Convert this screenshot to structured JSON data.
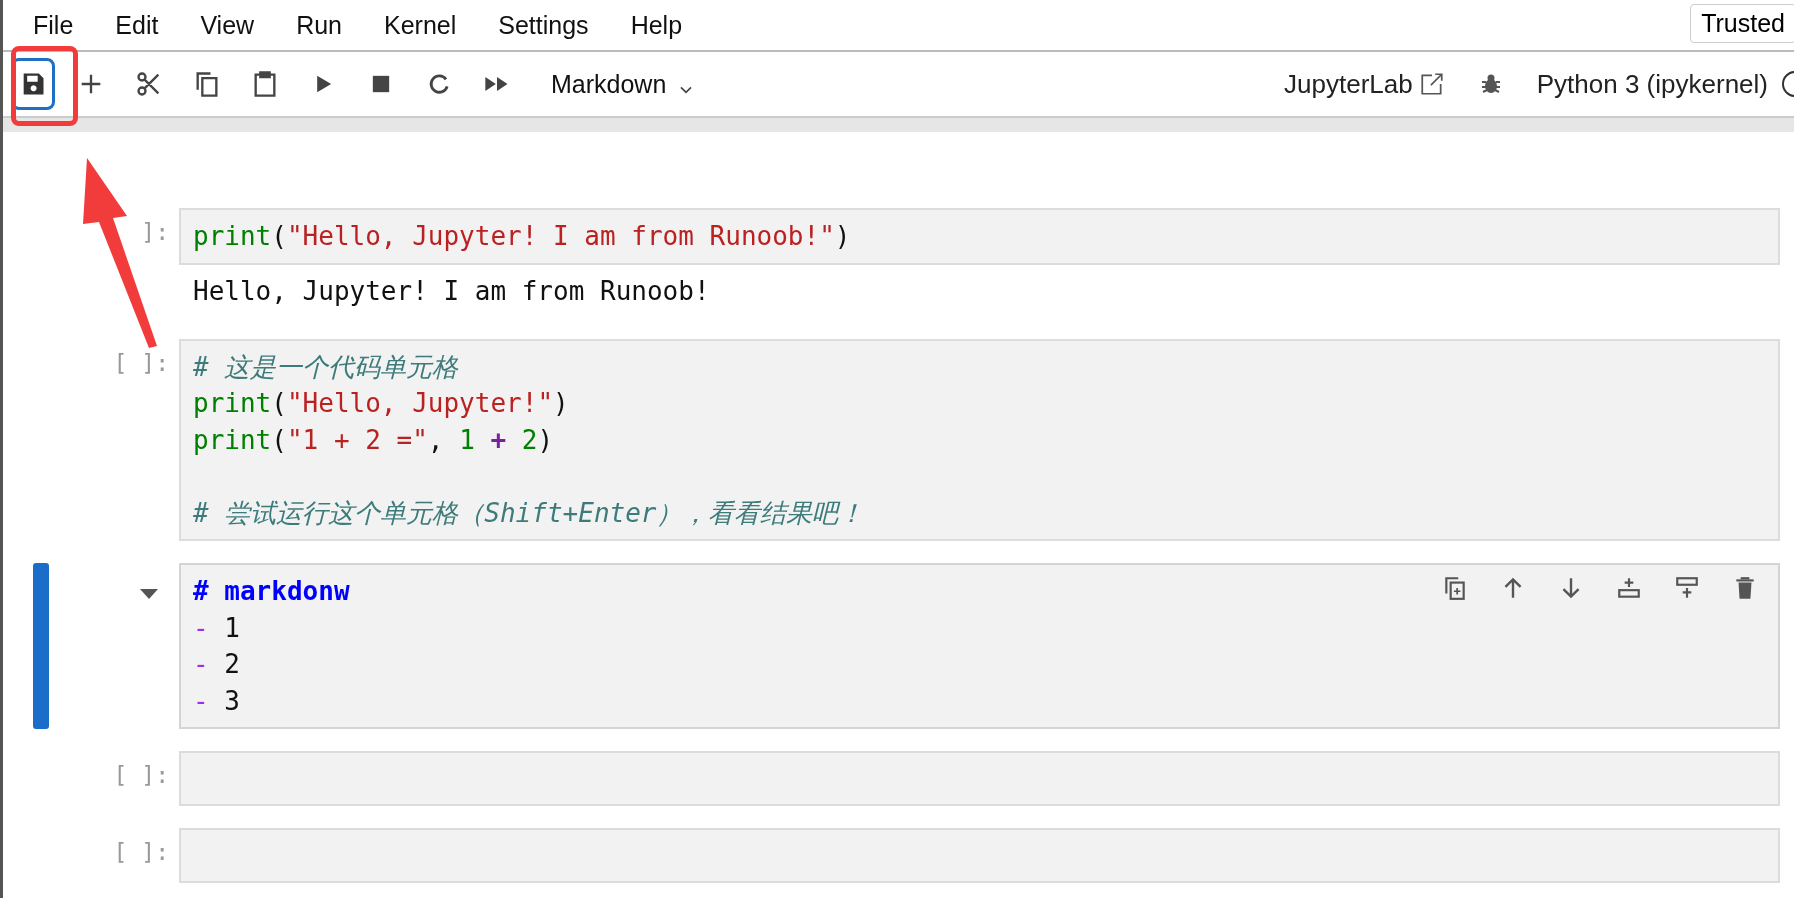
{
  "menu": [
    "File",
    "Edit",
    "View",
    "Run",
    "Kernel",
    "Settings",
    "Help"
  ],
  "trusted": "Trusted",
  "toolbar": {
    "buttons": [
      {
        "kind": "save",
        "focused": true
      },
      {
        "kind": "add",
        "focused": false
      },
      {
        "kind": "cut",
        "focused": false
      },
      {
        "kind": "copy",
        "focused": false
      },
      {
        "kind": "paste",
        "focused": false
      },
      {
        "kind": "run",
        "focused": false
      },
      {
        "kind": "stop",
        "focused": false
      },
      {
        "kind": "restart",
        "focused": false
      },
      {
        "kind": "run-all",
        "focused": false
      }
    ],
    "cell_type": "Markdown",
    "jupyterlab": "JupyterLab",
    "kernel": "Python 3 (ipykernel)"
  },
  "cells": [
    {
      "kind": "code",
      "prompt": "]:",
      "active": false,
      "lines": [
        {
          "tokens": [
            {
              "t": "print",
              "kind": "builtin"
            },
            {
              "t": "(",
              "kind": "punct"
            },
            {
              "t": "\"Hello, Jupyter! I am from Runoob!\"",
              "kind": "string"
            },
            {
              "t": ")",
              "kind": "punct"
            }
          ]
        }
      ],
      "output": "Hello, Jupyter! I am from Runoob!"
    },
    {
      "kind": "code",
      "prompt": "[ ]:",
      "active": false,
      "lines": [
        {
          "tokens": [
            {
              "t": "# 这是一个代码单元格",
              "kind": "comment"
            }
          ]
        },
        {
          "tokens": [
            {
              "t": "print",
              "kind": "builtin"
            },
            {
              "t": "(",
              "kind": "punct"
            },
            {
              "t": "\"Hello, Jupyter!\"",
              "kind": "string"
            },
            {
              "t": ")",
              "kind": "punct"
            }
          ]
        },
        {
          "tokens": [
            {
              "t": "print",
              "kind": "builtin"
            },
            {
              "t": "(",
              "kind": "punct"
            },
            {
              "t": "\"1 + 2 =\"",
              "kind": "string"
            },
            {
              "t": ", ",
              "kind": "punct"
            },
            {
              "t": "1 ",
              "kind": "number"
            },
            {
              "t": "+",
              "kind": "operator"
            },
            {
              "t": " 2",
              "kind": "number"
            },
            {
              "t": ")",
              "kind": "punct"
            }
          ]
        },
        {
          "tokens": [
            {
              "t": "# 尝试运行这个单元格（Shift+Enter），看看结果吧！",
              "kind": "comment"
            }
          ],
          "blank_before": true
        }
      ]
    },
    {
      "kind": "markdown",
      "active": true,
      "lines": [
        {
          "tokens": [
            {
              "t": "# markdonw",
              "kind": "heading"
            }
          ]
        },
        {
          "tokens": [
            {
              "t": "-",
              "kind": "bullet"
            },
            {
              "t": " 1",
              "kind": "punct"
            }
          ]
        },
        {
          "tokens": [
            {
              "t": "-",
              "kind": "bullet"
            },
            {
              "t": " 2",
              "kind": "punct"
            }
          ]
        },
        {
          "tokens": [
            {
              "t": "-",
              "kind": "bullet"
            },
            {
              "t": " 3",
              "kind": "punct"
            }
          ]
        }
      ]
    },
    {
      "kind": "code",
      "prompt": "[ ]:",
      "active": false
    },
    {
      "kind": "code",
      "prompt": "[ ]:",
      "active": false
    }
  ]
}
